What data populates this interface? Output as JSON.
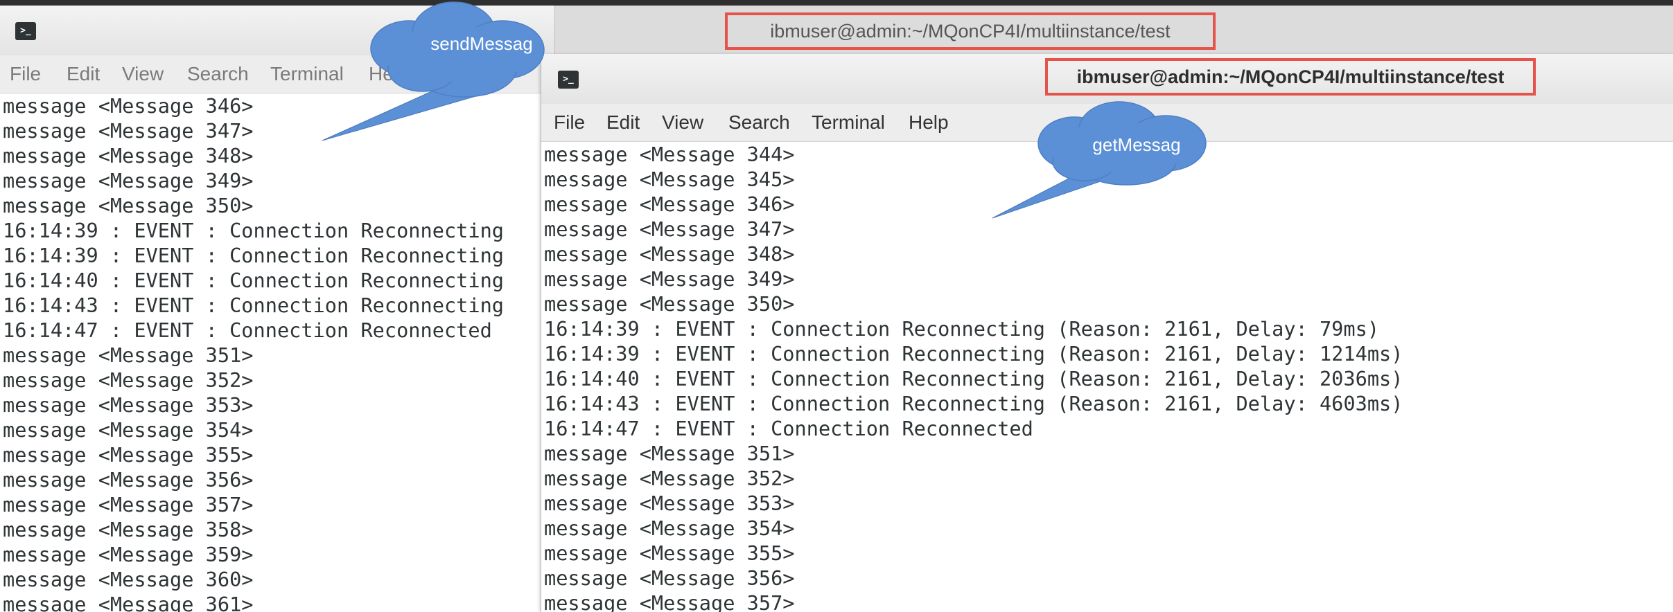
{
  "send_window": {
    "title": "ibmuser@admin:~/MQonCP4I/multiinstance/test",
    "menu": [
      "File",
      "Edit",
      "View",
      "Search",
      "Terminal",
      "Help"
    ],
    "lines": [
      "message <Message 346>",
      "message <Message 347>",
      "message <Message 348>",
      "message <Message 349>",
      "message <Message 350>",
      "16:14:39 : EVENT : Connection Reconnecting",
      "16:14:39 : EVENT : Connection Reconnecting",
      "16:14:40 : EVENT : Connection Reconnecting",
      "16:14:43 : EVENT : Connection Reconnecting",
      "16:14:47 : EVENT : Connection Reconnected",
      "message <Message 351>",
      "message <Message 352>",
      "message <Message 353>",
      "message <Message 354>",
      "message <Message 355>",
      "message <Message 356>",
      "message <Message 357>",
      "message <Message 358>",
      "message <Message 359>",
      "message <Message 360>",
      "message <Message 361>"
    ]
  },
  "get_window": {
    "title": "ibmuser@admin:~/MQonCP4I/multiinstance/test",
    "menu": [
      "File",
      "Edit",
      "View",
      "Search",
      "Terminal",
      "Help"
    ],
    "lines": [
      "message <Message 344>",
      "message <Message 345>",
      "message <Message 346>",
      "message <Message 347>",
      "message <Message 348>",
      "message <Message 349>",
      "message <Message 350>",
      "16:14:39 : EVENT : Connection Reconnecting (Reason: 2161, Delay: 79ms)",
      "16:14:39 : EVENT : Connection Reconnecting (Reason: 2161, Delay: 1214ms)",
      "16:14:40 : EVENT : Connection Reconnecting (Reason: 2161, Delay: 2036ms)",
      "16:14:43 : EVENT : Connection Reconnecting (Reason: 2161, Delay: 4603ms)",
      "16:14:47 : EVENT : Connection Reconnected",
      "message <Message 351>",
      "message <Message 352>",
      "message <Message 353>",
      "message <Message 354>",
      "message <Message 355>",
      "message <Message 356>",
      "message <Message 357>"
    ]
  },
  "callouts": {
    "send": "sendMessag",
    "get": "getMessag"
  },
  "colors": {
    "callout_fill": "#5b8fd6",
    "title_highlight": "#e5534b",
    "terminal_text": "#2e3436"
  },
  "icons": {
    "terminal": "terminal-icon"
  }
}
